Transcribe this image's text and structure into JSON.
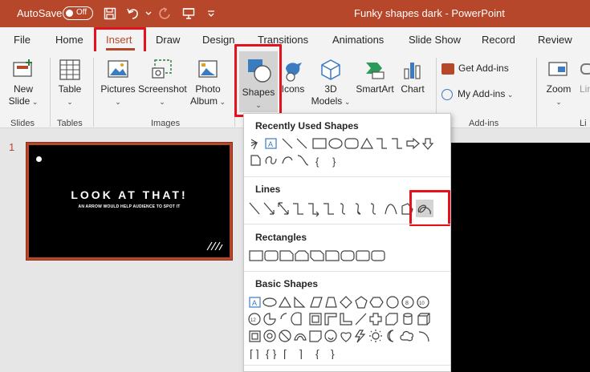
{
  "titlebar": {
    "autosave_label": "AutoSave",
    "toggle_state": "Off",
    "document_title": "Funky shapes dark - PowerPoint",
    "background_color": "#b7472a"
  },
  "tabs": [
    {
      "label": "File"
    },
    {
      "label": "Home"
    },
    {
      "label": "Insert",
      "active": true
    },
    {
      "label": "Draw"
    },
    {
      "label": "Design"
    },
    {
      "label": "Transitions"
    },
    {
      "label": "Animations"
    },
    {
      "label": "Slide Show"
    },
    {
      "label": "Record"
    },
    {
      "label": "Review"
    }
  ],
  "ribbon": {
    "new_slide": "New\nSlide",
    "table": "Table",
    "pictures": "Pictures",
    "screenshot": "Screenshot",
    "photo_album": "Photo\nAlbum",
    "shapes": "Shapes",
    "icons": "Icons",
    "models_3d": "3D\nModels",
    "smartart": "SmartArt",
    "chart": "Chart",
    "get_addins": "Get Add-ins",
    "my_addins": "My Add-ins",
    "zoom": "Zoom",
    "link_partial": "Lin",
    "groups": {
      "slides": "Slides",
      "tables": "Tables",
      "images": "Images",
      "addins": "Add-ins",
      "links_partial": "Li"
    }
  },
  "slide_panel": {
    "slide_number": "1",
    "thumb_title": "LOOK AT THAT!",
    "thumb_subtitle": "AN ARROW WOULD HELP AUDIENCE TO SPOT IT"
  },
  "shapes_menu": {
    "sections": [
      {
        "name": "Recently Used Shapes"
      },
      {
        "name": "Lines"
      },
      {
        "name": "Rectangles"
      },
      {
        "name": "Basic Shapes"
      }
    ],
    "highlighted_shape": "scribble"
  },
  "colors": {
    "accent": "#b7472a",
    "highlight_box": "#e3121d",
    "ribbon_bg": "#f3f3f3"
  }
}
